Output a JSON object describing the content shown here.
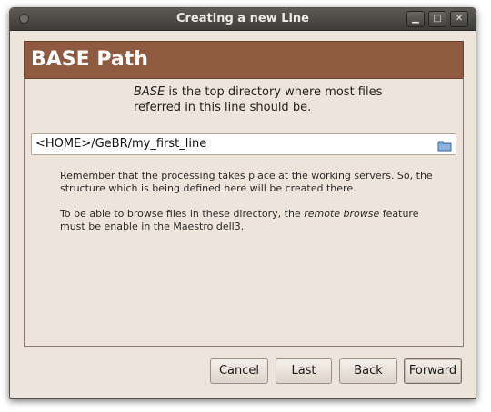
{
  "window": {
    "title": "Creating a new Line",
    "controls": {
      "minimize": "▁",
      "maximize": "□",
      "close": "✕"
    }
  },
  "banner": {
    "title": "BASE Path"
  },
  "intro": {
    "emphasis": "BASE",
    "rest": " is the top directory where most files referred in this line should be."
  },
  "path_field": {
    "value": "<HOME>/GeBR/my_first_line",
    "icon": "folder-icon"
  },
  "notes": {
    "p1": "Remember that the processing takes place at the working servers. So, the structure which is being defined here will be created there.",
    "p2_before": "To be able to browse files in these directory, the ",
    "p2_emphasis": "remote browse",
    "p2_after": " feature must be enable in the Maestro dell3."
  },
  "buttons": {
    "cancel": "Cancel",
    "last": "Last",
    "back": "Back",
    "forward": "Forward"
  },
  "colors": {
    "banner": "#8e5b40",
    "window_bg": "#ede5dc",
    "titlebar": "#4a4844"
  }
}
